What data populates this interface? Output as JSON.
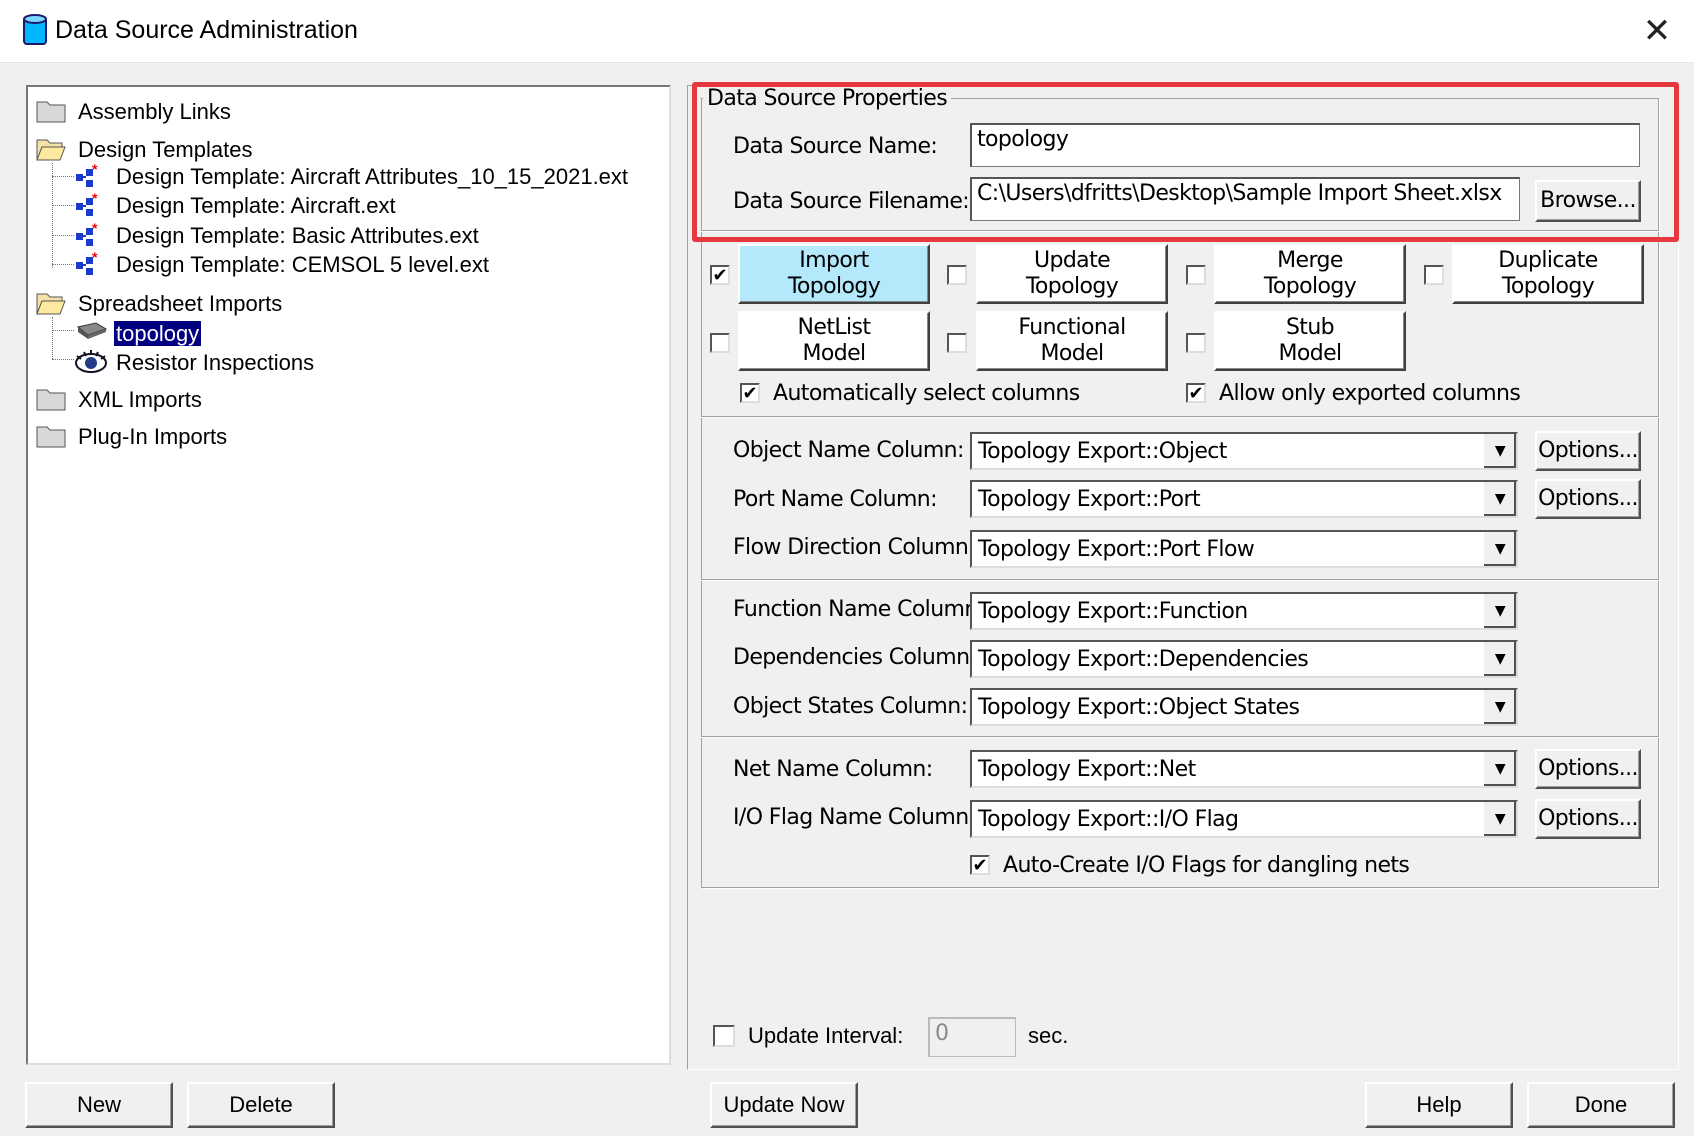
{
  "window": {
    "title": "Data Source Administration",
    "close_glyph": "✕"
  },
  "tree": {
    "assembly_links": "Assembly Links",
    "design_templates": "Design Templates",
    "templates": [
      "Design Template: Aircraft Attributes_10_15_2021.ext",
      "Design Template: Aircraft.ext",
      "Design Template: Basic Attributes.ext",
      "Design Template: CEMSOL 5 level.ext"
    ],
    "spreadsheet_imports": "Spreadsheet Imports",
    "spreadsheet_items": [
      "topology",
      "Resistor Inspections"
    ],
    "selected_item": "topology",
    "xml_imports": "XML Imports",
    "plugin_imports": "Plug-In Imports"
  },
  "props": {
    "group_title": "Data Source Properties",
    "name_label": "Data Source Name:",
    "name_value": "topology",
    "filename_label": "Data Source Filename:",
    "filename_value": "C:\\Users\\dfritts\\Desktop\\Sample Import Sheet.xlsx",
    "browse": "Browse..."
  },
  "modes": {
    "import_topology": {
      "line1": "Import",
      "line2": "Topology",
      "checked": true
    },
    "update_topology": {
      "line1": "Update",
      "line2": "Topology",
      "checked": false
    },
    "merge_topology": {
      "line1": "Merge",
      "line2": "Topology",
      "checked": false
    },
    "duplicate_topology": {
      "line1": "Duplicate",
      "line2": "Topology",
      "checked": false
    },
    "netlist_model": {
      "line1": "NetList",
      "line2": "Model",
      "checked": false
    },
    "functional_model": {
      "line1": "Functional",
      "line2": "Model",
      "checked": false
    },
    "stub_model": {
      "line1": "Stub",
      "line2": "Model",
      "checked": false
    },
    "auto_select": "Automatically select columns",
    "exported_only": "Allow only exported columns"
  },
  "columns": {
    "object_name": {
      "label": "Object Name Column:",
      "value": "Topology Export::Object"
    },
    "port_name": {
      "label": "Port Name Column:",
      "value": "Topology Export::Port"
    },
    "flow_direction": {
      "label": "Flow Direction Column:",
      "value": "Topology Export::Port Flow"
    },
    "function_name": {
      "label": "Function Name Column:",
      "value": "Topology Export::Function"
    },
    "dependencies": {
      "label": "Dependencies Column:",
      "value": "Topology Export::Dependencies"
    },
    "object_states": {
      "label": "Object States Column:",
      "value": "Topology Export::Object States"
    },
    "net_name": {
      "label": "Net Name Column:",
      "value": "Topology Export::Net"
    },
    "io_flag": {
      "label": "I/O Flag Name Column:",
      "value": "Topology Export::I/O Flag"
    },
    "options": "Options...",
    "auto_create": "Auto-Create I/O Flags for dangling nets"
  },
  "update": {
    "label": "Update Interval:",
    "value": "0",
    "unit": "sec."
  },
  "buttons": {
    "new": "New",
    "delete": "Delete",
    "update_now": "Update Now",
    "help": "Help",
    "done": "Done"
  },
  "check_glyph": "✔",
  "colors": {
    "highlight": "#e8383f",
    "selection": "#000080",
    "active_mode": "#b4e8fb"
  }
}
